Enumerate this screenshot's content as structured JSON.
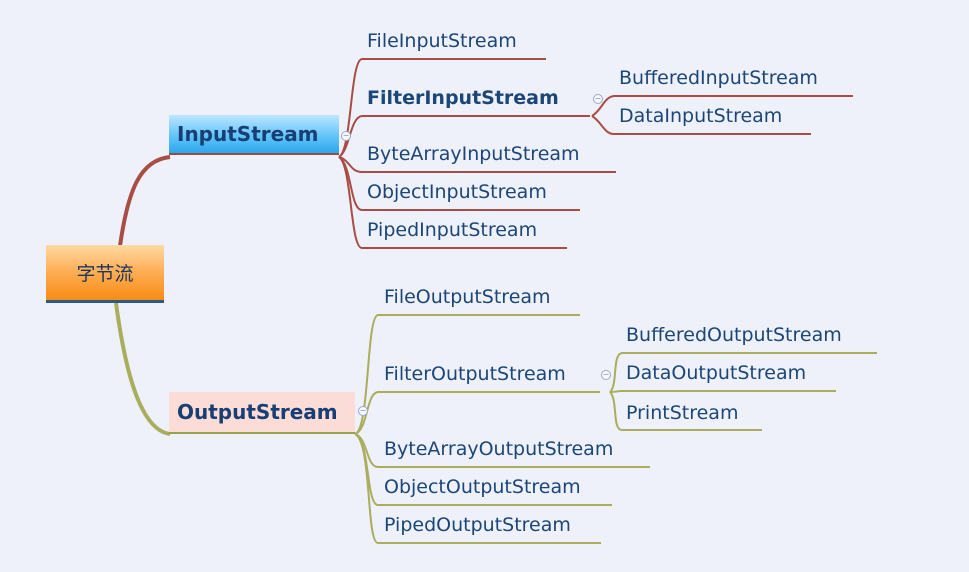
{
  "root": {
    "label": "字节流"
  },
  "input": {
    "label": "InputStream",
    "children": [
      {
        "label": "FileInputStream"
      },
      {
        "label": "FilterInputStream",
        "children": [
          {
            "label": "BufferedInputStream"
          },
          {
            "label": "DataInputStream"
          }
        ]
      },
      {
        "label": "ByteArrayInputStream"
      },
      {
        "label": "ObjectInputStream"
      },
      {
        "label": "PipedInputStream"
      }
    ]
  },
  "output": {
    "label": "OutputStream",
    "children": [
      {
        "label": "FileOutputStream"
      },
      {
        "label": "FilterOutputStream",
        "children": [
          {
            "label": "BufferedOutputStream"
          },
          {
            "label": "DataOutputStream"
          },
          {
            "label": "PrintStream"
          }
        ]
      },
      {
        "label": "ByteArrayOutputStream"
      },
      {
        "label": "ObjectOutputStream"
      },
      {
        "label": "PipedOutputStream"
      }
    ]
  },
  "colors": {
    "input_branch": "#a94d44",
    "output_branch": "#a9ad5c",
    "text": "#1b4677"
  },
  "icons": {
    "collapse": "collapse-minus-icon"
  }
}
